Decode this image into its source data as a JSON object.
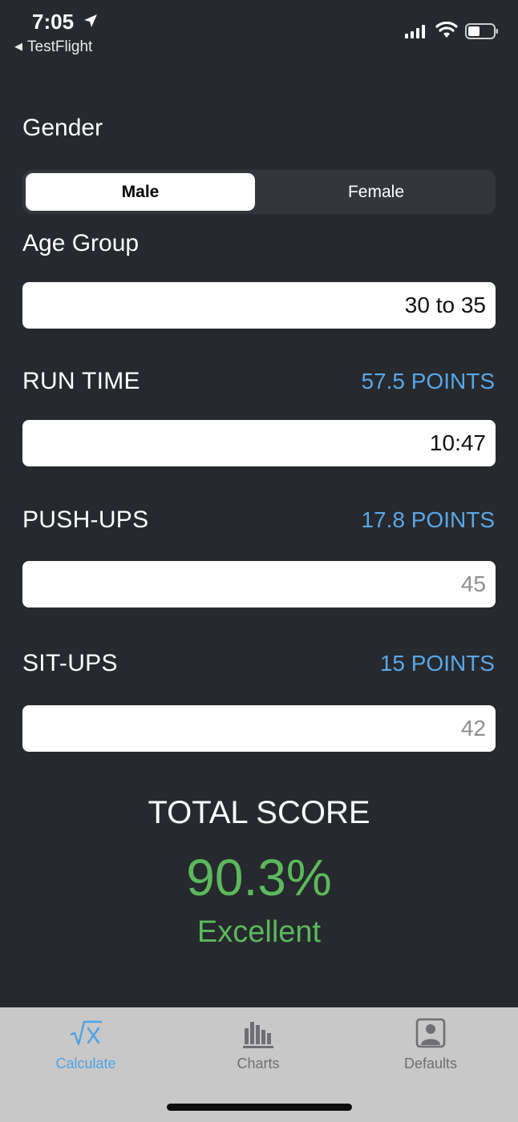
{
  "status_bar": {
    "time": "7:05",
    "back_app": "TestFlight"
  },
  "gender": {
    "label": "Gender",
    "options": [
      "Male",
      "Female"
    ],
    "selected": "Male"
  },
  "age_group": {
    "label": "Age Group",
    "value": "30 to 35"
  },
  "run_time": {
    "label": "RUN TIME",
    "points": "57.5 POINTS",
    "value": "10:47"
  },
  "push_ups": {
    "label": "PUSH-UPS",
    "points": "17.8 POINTS",
    "placeholder": "45"
  },
  "sit_ups": {
    "label": "SIT-UPS",
    "points": "15 POINTS",
    "placeholder": "42"
  },
  "total": {
    "label": "TOTAL SCORE",
    "value": "90.3%",
    "rating": "Excellent"
  },
  "tabs": [
    {
      "label": "Calculate",
      "icon": "sqrt-x-icon",
      "active": true
    },
    {
      "label": "Charts",
      "icon": "bar-chart-icon",
      "active": false
    },
    {
      "label": "Defaults",
      "icon": "person-frame-icon",
      "active": false
    }
  ],
  "colors": {
    "background": "#26292e",
    "accent_blue": "#5aa7e6",
    "score_green": "#5cb85c",
    "tabbar": "#c8c8c8"
  }
}
